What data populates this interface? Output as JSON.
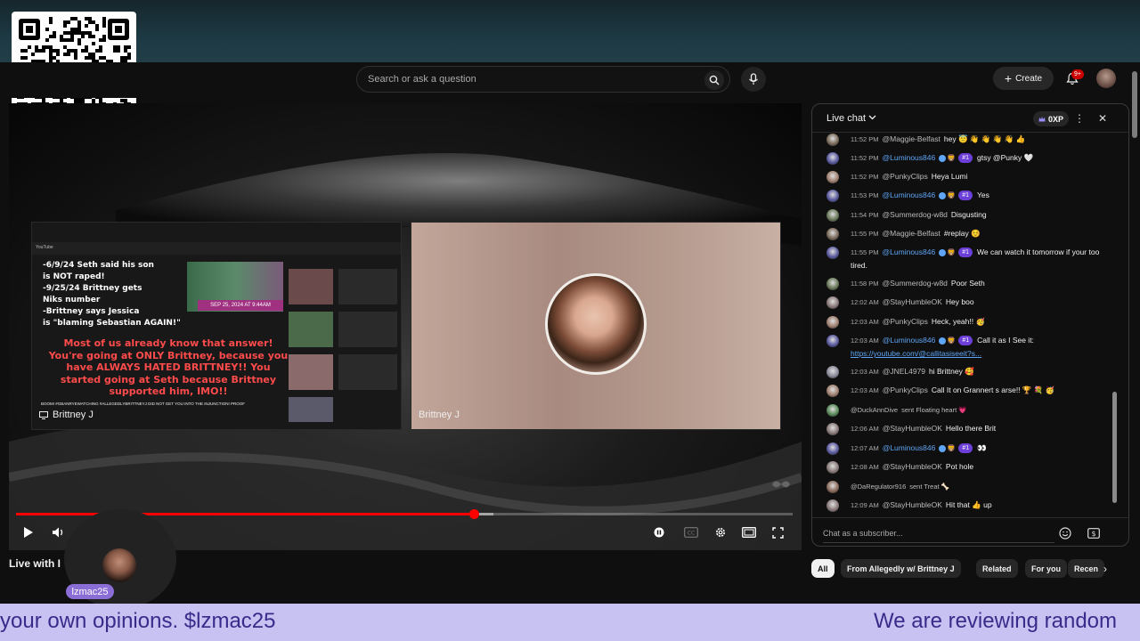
{
  "search": {
    "placeholder": "Search or ask a question"
  },
  "header": {
    "create_label": "Create",
    "notification_count": "9+"
  },
  "player": {
    "left_tile_label": "Brittney J",
    "right_tile_label": "Brittney J",
    "overlay_lines": [
      "-6/9/24 Seth said his son",
      "is NOT raped!",
      "-9/25/24 Brittney gets",
      "Niks number",
      "-Brittney says Jessica",
      "is \"blaming Sebastian AGAIN!\""
    ],
    "date_banner": "SEP 25, 2024 AT 9:44AM",
    "red_text": "Most of us already know that answer! You're going at ONLY Brittney, because you have ALWAYS HATED BRITTNEY!! You started going at Seth because Brittney supported him, IMO!!",
    "small_ticker": "BOOM! #GBANRYEWATCHING #ALLEGEDLYBRITTNEYJ DID NOT GET YOU INTO THE INJUNCTION! PROOF",
    "progress_played": 0.59,
    "progress_buffered": 0.615
  },
  "video_title": "Live with I",
  "cam_bubble_tag": "lzmac25",
  "chat": {
    "title": "Live chat",
    "xp": "0XP",
    "input_placeholder": "Chat as a subscriber...",
    "messages": [
      {
        "time": "11:52 PM",
        "author": "@Maggie-Belfast",
        "text": "hey 😇 👋 👋 👋 👋 👍",
        "color": "#7a6a5a"
      },
      {
        "time": "11:52 PM",
        "author": "@Luminous846",
        "special": true,
        "rank": "#1",
        "text": "gtsy @Punky 🤍",
        "color": "#5a5aa0"
      },
      {
        "time": "11:52 PM",
        "author": "@PunkyClips",
        "text": "Heya Lumi",
        "color": "#a08070"
      },
      {
        "time": "11:53 PM",
        "author": "@Luminous846",
        "special": true,
        "rank": "#1",
        "text": "Yes",
        "color": "#5a5aa0"
      },
      {
        "time": "11:54 PM",
        "author": "@Summerdog-w8d",
        "text": "Disgusting",
        "color": "#6a7a5a"
      },
      {
        "time": "11:55 PM",
        "author": "@Maggie-Belfast",
        "text": "#replay ☺️",
        "color": "#7a6a5a"
      },
      {
        "time": "11:55 PM",
        "author": "@Luminous846",
        "special": true,
        "rank": "#1",
        "text": "We can watch it tomorrow if your too tired.",
        "color": "#5a5aa0"
      },
      {
        "time": "11:58 PM",
        "author": "@Summerdog-w8d",
        "text": "Poor Seth",
        "color": "#6a7a5a"
      },
      {
        "time": "12:02 AM",
        "author": "@StayHumbleOK",
        "text": "Hey boo",
        "color": "#8a7a7a"
      },
      {
        "time": "12:03 AM",
        "author": "@PunkyClips",
        "text": "Heck, yeah!! 🥳",
        "color": "#a08070"
      },
      {
        "time": "12:03 AM",
        "author": "@Luminous846",
        "special": true,
        "rank": "#1",
        "text": "Call it as I See it:",
        "link": "https://youtube.com/@callitasiseeit?s...",
        "color": "#5a5aa0"
      },
      {
        "time": "12:03 AM",
        "author": "@JNEL4979",
        "text": "hi Brittney 🥰",
        "color": "#8a8a9a"
      },
      {
        "time": "12:03 AM",
        "author": "@PunkyClips",
        "text": "Call It on Grannert s arse!! 🏆 💐 🥳",
        "color": "#a08070"
      },
      {
        "time": "",
        "author": "@DuckAnnDive",
        "system": true,
        "text": "sent Floating heart 💗",
        "color": "#5a8a5a"
      },
      {
        "time": "12:06 AM",
        "author": "@StayHumbleOK",
        "text": "Hello there Brit",
        "color": "#8a7a7a"
      },
      {
        "time": "12:07 AM",
        "author": "@Luminous846",
        "special": true,
        "rank": "#1",
        "text": "👀",
        "color": "#5a5aa0"
      },
      {
        "time": "12:08 AM",
        "author": "@StayHumbleOK",
        "text": "Pot hole",
        "color": "#8a7a7a"
      },
      {
        "time": "",
        "author": "@DaRegulator916",
        "system": true,
        "text": "sent Treat 🦴",
        "color": "#8a6a5a"
      },
      {
        "time": "12:09 AM",
        "author": "@StayHumbleOK",
        "text": "Hit that 👍 up",
        "color": "#8a7a7a"
      }
    ]
  },
  "chips": [
    "All",
    "From Allegedly w/ Brittney J",
    "Related",
    "For you",
    "Recen"
  ],
  "ticker": {
    "left": "your own opinions. $lzmac25",
    "right": "We are reviewing random"
  }
}
